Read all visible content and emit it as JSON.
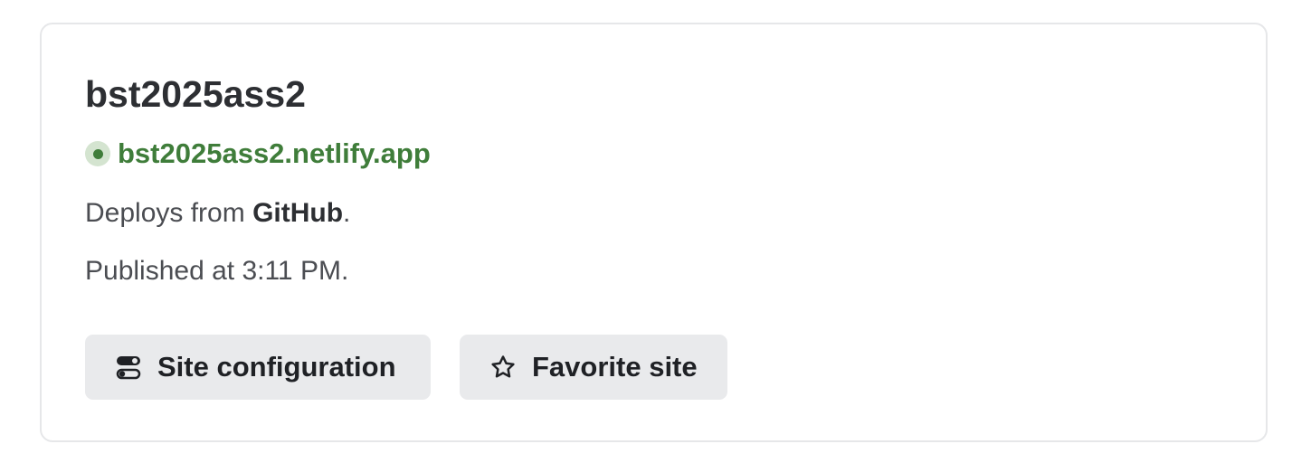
{
  "site": {
    "name": "bst2025ass2",
    "url": "bst2025ass2.netlify.app",
    "status_color": "#3f7d3a",
    "deploy_prefix": "Deploys from ",
    "deploy_source": "GitHub",
    "deploy_suffix": ".",
    "published_text": "Published at 3:11 PM."
  },
  "actions": {
    "config_label": "Site configuration",
    "config_icon": "toggles-icon",
    "favorite_label": "Favorite site",
    "favorite_icon": "star-icon"
  }
}
